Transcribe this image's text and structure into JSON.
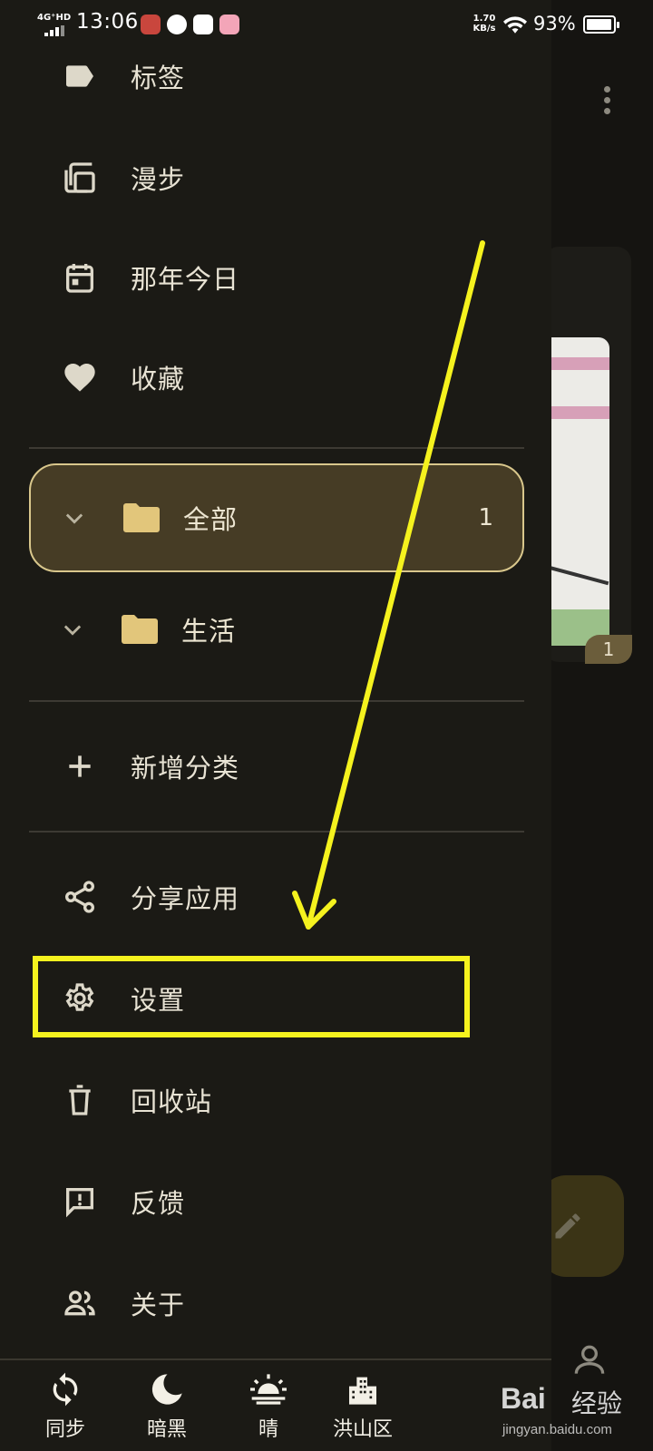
{
  "status_bar": {
    "network": "4G⁺HD",
    "time": "13:06",
    "speed_value": "1.70",
    "speed_unit": "KB/s",
    "battery": "93%"
  },
  "drawer": {
    "top_items": [
      {
        "label": "标签",
        "icon": "label-icon"
      },
      {
        "label": "漫步",
        "icon": "library-icon"
      },
      {
        "label": "那年今日",
        "icon": "calendar-icon"
      },
      {
        "label": "收藏",
        "icon": "heart-icon"
      }
    ],
    "folders": [
      {
        "label": "全部",
        "count": "1",
        "selected": true
      },
      {
        "label": "生活",
        "count": "",
        "selected": false
      }
    ],
    "add_category": "新增分类",
    "bottom_items": [
      {
        "label": "分享应用",
        "icon": "share-icon"
      },
      {
        "label": "设置",
        "icon": "gear-icon"
      },
      {
        "label": "回收站",
        "icon": "trash-icon"
      },
      {
        "label": "反馈",
        "icon": "feedback-icon"
      },
      {
        "label": "关于",
        "icon": "people-icon"
      }
    ]
  },
  "bottom_bar": [
    {
      "label": "同步",
      "icon": "sync-icon"
    },
    {
      "label": "暗黑",
      "icon": "moon-icon"
    },
    {
      "label": "晴",
      "icon": "sunny-icon"
    },
    {
      "label": "洪山区",
      "icon": "city-icon"
    }
  ],
  "background": {
    "badge_count": "1"
  },
  "watermark": {
    "brand": "Bai",
    "brand_cn": "经验",
    "url": "jingyan.baidu.com"
  },
  "colors": {
    "drawer_bg": "#1b1a15",
    "selected_bg": "#463c25",
    "selected_border": "#d9c78c",
    "folder_icon": "#e2c67b",
    "annotation": "#f5f21e"
  }
}
